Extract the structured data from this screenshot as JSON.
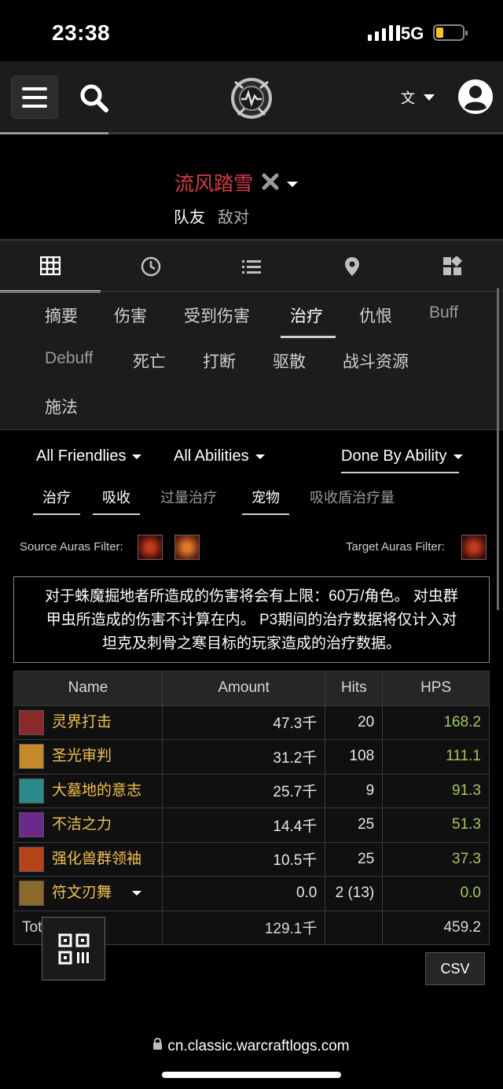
{
  "status_bar": {
    "time": "23:38",
    "network": "5G",
    "battery_percent": 20
  },
  "header": {
    "logo": "warcraftlogs-logo-icon"
  },
  "target": {
    "name": "流风踏雪",
    "friendly_label": "队友",
    "enemy_label": "敌对"
  },
  "view_tabs": [
    {
      "icon": "table-grid-icon",
      "active": true
    },
    {
      "icon": "clock-icon"
    },
    {
      "icon": "list-icon"
    },
    {
      "icon": "map-pin-icon"
    },
    {
      "icon": "widgets-icon"
    }
  ],
  "categories": {
    "row1": [
      "摘要",
      "伤害",
      "受到伤害",
      "治疗",
      "仇恨",
      "Buff"
    ],
    "row2": [
      "Debuff",
      "死亡",
      "打断",
      "驱散",
      "战斗资源"
    ],
    "row3": [
      "施法"
    ],
    "active": "治疗"
  },
  "filters": {
    "friendlies": "All Friendlies",
    "abilities": "All Abilities",
    "grouping": "Done By Ability"
  },
  "toggles": {
    "healing": "治疗",
    "absorb": "吸收",
    "overheal": "过量治疗",
    "pets": "宠物",
    "absorb_shield": "吸收盾治疗量"
  },
  "auras": {
    "source_label": "Source Auras Filter:",
    "target_label": "Target Auras Filter:"
  },
  "notice": {
    "line1": "对于蛛魔掘地者所造成的伤害将会有上限：60万/角色。 对虫群",
    "line2": "甲虫所造成的伤害不计算在内。 P3期间的治疗数据将仅计入对",
    "line3": "坦克及刺骨之寒目标的玩家造成的治疗数据。"
  },
  "table": {
    "headers": {
      "name": "Name",
      "amount": "Amount",
      "hits": "Hits",
      "hps": "HPS"
    },
    "rows": [
      {
        "name": "灵界打击",
        "amount": "47.3千",
        "hits": "20",
        "hps": "168.2",
        "icon_color": "#8a2a2a"
      },
      {
        "name": "圣光审判",
        "amount": "31.2千",
        "hits": "108",
        "hps": "111.1",
        "icon_color": "#c48a2a"
      },
      {
        "name": "大墓地的意志",
        "amount": "25.7千",
        "hits": "9",
        "hps": "91.3",
        "icon_color": "#2a8a8a"
      },
      {
        "name": "不洁之力",
        "amount": "14.4千",
        "hits": "25",
        "hps": "51.3",
        "icon_color": "#6a2a8a"
      },
      {
        "name": "强化兽群领袖",
        "amount": "10.5千",
        "hits": "25",
        "hps": "37.3",
        "icon_color": "#b4441a"
      },
      {
        "name": "符文刃舞",
        "amount": "0.0",
        "hits": "2 (13)",
        "hps": "0.0",
        "icon_color": "#8a6a2a"
      }
    ],
    "total": {
      "label": "Total",
      "amount": "129.1千",
      "hps": "459.2"
    }
  },
  "csv_label": "CSV",
  "url": "cn.classic.warcraftlogs.com"
}
